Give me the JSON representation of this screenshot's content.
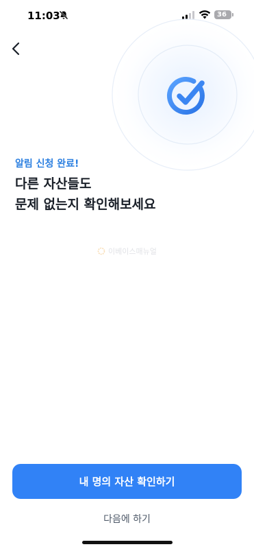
{
  "status_bar": {
    "time": "11:03",
    "battery_level": "36"
  },
  "hero": {
    "eyebrow": "알림 신청 완료!",
    "headline_lines": [
      "다른 자산들도",
      "문제 없는지 확인해보세요"
    ]
  },
  "watermark": {
    "text": "이베이스매뉴얼"
  },
  "actions": {
    "primary_label": "내 명의 자산 확인하기",
    "secondary_label": "다음에 하기"
  },
  "colors": {
    "accent": "#3182f6",
    "eyebrow": "#2b7fe0",
    "headline": "#191f28",
    "secondary_text": "#4e5968"
  },
  "icons": [
    "bell-slash-icon",
    "cellular-signal-icon",
    "wifi-icon",
    "battery-icon",
    "chevron-left-icon",
    "check-circle-icon",
    "watermark-logo-icon"
  ]
}
